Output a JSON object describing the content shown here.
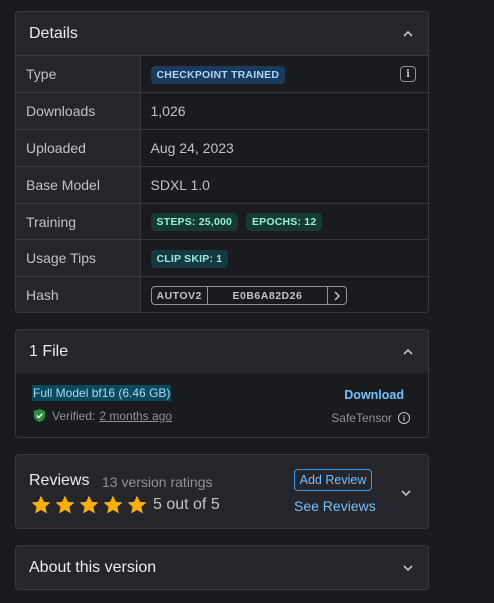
{
  "details": {
    "title": "Details",
    "rows": {
      "type": {
        "label": "Type",
        "badge": "CHECKPOINT TRAINED"
      },
      "downloads": {
        "label": "Downloads",
        "value": "1,026"
      },
      "uploaded": {
        "label": "Uploaded",
        "value": "Aug 24, 2023"
      },
      "base_model": {
        "label": "Base Model",
        "value": "SDXL 1.0"
      },
      "training": {
        "label": "Training",
        "badges": [
          "STEPS: 25,000",
          "EPOCHS: 12"
        ]
      },
      "usage_tips": {
        "label": "Usage Tips",
        "badge": "CLIP SKIP: 1"
      },
      "hash": {
        "label": "Hash",
        "algo": "AUTOV2",
        "value": "E0B6A82D26"
      }
    }
  },
  "files": {
    "title": "1 File",
    "file_name": "Full Model bf16 (6.46 GB)",
    "download_label": "Download",
    "verified_label": "Verified:",
    "verified_time": "2 months ago",
    "format": "SafeTensor"
  },
  "reviews": {
    "title": "Reviews",
    "count_text": "13 version ratings",
    "rating_text": "5 out of 5",
    "rating_value": 5,
    "add_review_label": "Add Review",
    "see_reviews_label": "See Reviews"
  },
  "about": {
    "title": "About this version"
  },
  "colors": {
    "background": "#1a1b1e",
    "card": "#25262b",
    "accent_blue": "#74c0fc",
    "star": "#fab005",
    "verified_green": "#40c057"
  }
}
